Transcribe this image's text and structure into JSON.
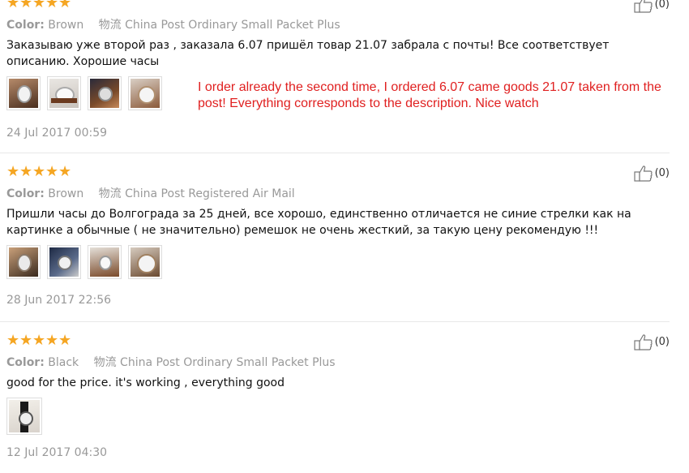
{
  "reviews": [
    {
      "rating": 5,
      "likes": "(0)",
      "color_label": "Color:",
      "color_value": "Brown",
      "shipping": "物流 China Post Ordinary Small Packet Plus",
      "text": "Заказываю уже второй раз , заказала 6.07 пришёл товар 21.07 забрала с почты! Все соответствует описанию. Хорошие часы",
      "translation": "I order already the second time, I ordered 6.07 came goods 21.07 taken from the post! Everything corresponds to the description. Nice watch",
      "date": "24 Jul 2017 00:59",
      "photos": 4
    },
    {
      "rating": 5,
      "likes": "(0)",
      "color_label": "Color:",
      "color_value": "Brown",
      "shipping": "物流 China Post Registered Air Mail",
      "text": "Пришли часы до Волгограда за 25 дней, все хорошо, единственно отличается не синие стрелки как на картинке а обычные ( не значительно) ремешок не очень жесткий, за такую цену рекомендую !!!",
      "date": "28 Jun 2017 22:56",
      "photos": 4
    },
    {
      "rating": 5,
      "likes": "(0)",
      "color_label": "Color:",
      "color_value": "Black",
      "shipping": "物流 China Post Ordinary Small Packet Plus",
      "text": "good for the price. it's working , everything good",
      "date": "12 Jul 2017 04:30",
      "photos": 1
    }
  ],
  "colors": {
    "star": "#f5a623",
    "translation": "#e02020",
    "muted": "#999999"
  }
}
